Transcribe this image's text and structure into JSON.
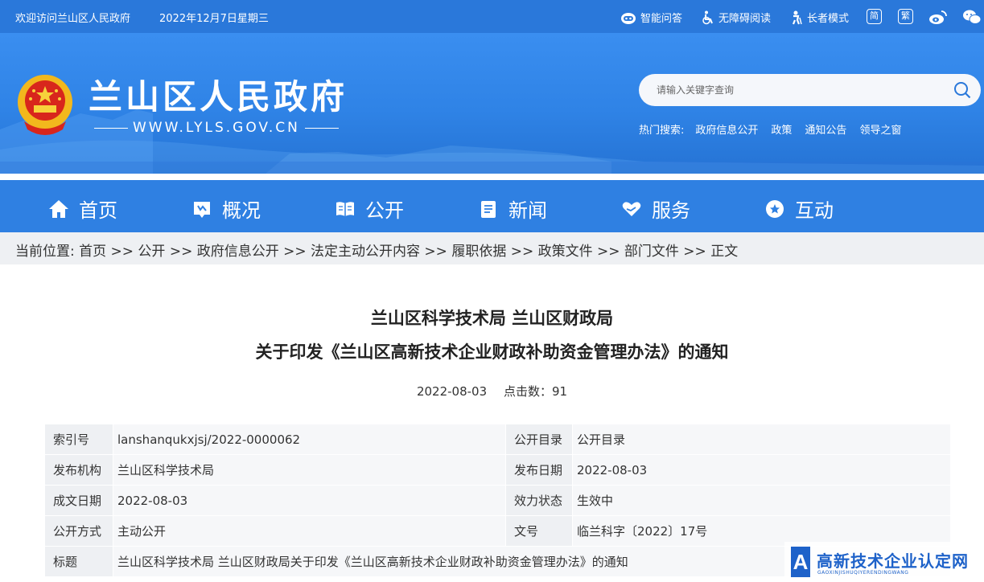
{
  "topbar": {
    "welcome": "欢迎访问兰山区人民政府",
    "date": "2022年12月7日星期三",
    "tools": {
      "ai": "智能问答",
      "accessible": "无障碍阅读",
      "elder": "长者模式",
      "simplified": "简",
      "traditional": "繁"
    }
  },
  "header": {
    "title": "兰山区人民政府",
    "url": "WWW.LYLS.GOV.CN",
    "search_placeholder": "请输入关键字查询",
    "hot_label": "热门搜索:",
    "hot_items": [
      "政府信息公开",
      "政策",
      "通知公告",
      "领导之窗"
    ]
  },
  "nav": {
    "items": [
      {
        "label": "首页",
        "icon": "home-icon"
      },
      {
        "label": "概况",
        "icon": "overview-icon"
      },
      {
        "label": "公开",
        "icon": "book-icon"
      },
      {
        "label": "新闻",
        "icon": "news-icon"
      },
      {
        "label": "服务",
        "icon": "heart-hand-icon"
      },
      {
        "label": "互动",
        "icon": "chat-icon"
      }
    ]
  },
  "breadcrumb": {
    "text": "当前位置: 首页 >> 公开 >> 政府信息公开 >> 法定主动公开内容 >> 履职依据 >> 政策文件 >> 部门文件 >> 正文"
  },
  "article": {
    "title_line1": "兰山区科学技术局 兰山区财政局",
    "title_line2": "关于印发《兰山区高新技术企业财政补助资金管理办法》的通知",
    "date": "2022-08-03",
    "clicks": "点击数：91"
  },
  "info": {
    "index_label": "索引号",
    "index_value": "lanshanqukxjsj/2022-0000062",
    "catalog_label": "公开目录",
    "catalog_value": "公开目录",
    "issuer_label": "发布机构",
    "issuer_value": "兰山区科学技术局",
    "pubdate_label": "发布日期",
    "pubdate_value": "2022-08-03",
    "written_label": "成文日期",
    "written_value": "2022-08-03",
    "status_label": "效力状态",
    "status_value": "生效中",
    "mode_label": "公开方式",
    "mode_value": "主动公开",
    "docno_label": "文号",
    "docno_value": "临兰科字〔2022〕17号",
    "subject_label": "标题",
    "subject_value": "兰山区科学技术局 兰山区财政局关于印发《兰山区高新技术企业财政补助资金管理办法》的通知"
  },
  "watermark": {
    "text": "高新技术企业认定网",
    "sub": "GAOXINJISHUQIYERENDINGWANG",
    "logo_letter": "A"
  },
  "colors": {
    "topbar": "#2a78da",
    "nav": "#2f80e2",
    "breadcrumb_bg": "#eef0f3",
    "watermark": "#1e62c9"
  }
}
